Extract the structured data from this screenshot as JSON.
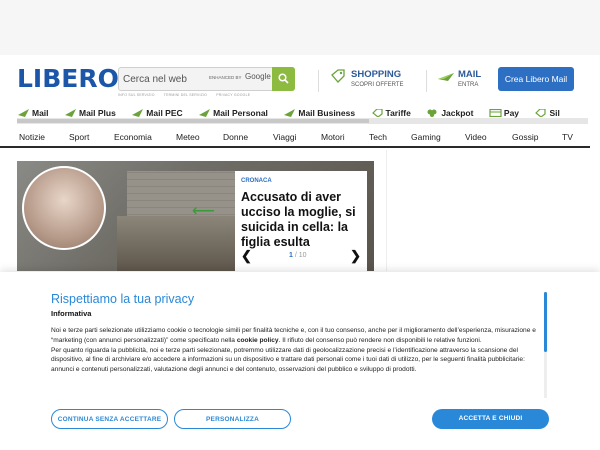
{
  "header": {
    "logo": "LIBERO",
    "search_placeholder": "Cerca nel web",
    "powered_by": "ENHANCED BY",
    "google": "Google",
    "sublinks": [
      "INFO SUL SERVIZIO",
      "TERMINI DEL SERVIZIO",
      "PRIVACY GOOGLE"
    ],
    "shopping_title": "SHOPPING",
    "shopping_sub": "SCOPRI OFFERTE",
    "mail_title": "MAIL",
    "mail_sub": "ENTRA",
    "crea_button": "Crea Libero Mail"
  },
  "services": [
    {
      "label": "Mail",
      "icon": "mail-icon"
    },
    {
      "label": "Mail Plus",
      "icon": "mail-icon"
    },
    {
      "label": "Mail PEC",
      "icon": "mail-icon"
    },
    {
      "label": "Mail Personal",
      "icon": "mail-icon"
    },
    {
      "label": "Mail Business",
      "icon": "mail-icon"
    },
    {
      "label": "Tariffe",
      "icon": "tag-icon"
    },
    {
      "label": "Jackpot",
      "icon": "clover-icon"
    },
    {
      "label": "Pay",
      "icon": "card-icon"
    },
    {
      "label": "Sil",
      "icon": "tag-icon"
    }
  ],
  "categories": [
    "Notizie",
    "Sport",
    "Economia",
    "Meteo",
    "Donne",
    "Viaggi",
    "Motori",
    "Tech",
    "Gaming",
    "Video",
    "Gossip",
    "TV"
  ],
  "hero": {
    "category": "CRONACA",
    "title": "Accusato di aver ucciso la moglie, si suicida in cella: la figlia esulta",
    "pager_current": "1",
    "pager_total": "/ 10"
  },
  "privacy": {
    "title": "Rispettiamo la tua privacy",
    "subtitle": "Informativa",
    "p1_a": "Noi e terze parti selezionate utilizziamo cookie o tecnologie simili per finalità tecniche e, con il tuo consenso, anche per il miglioramento dell’esperienza, misurazione e “marketing (con annunci personalizzati)” come specificato nella ",
    "p1_link": "cookie policy",
    "p1_b": ". Il rifiuto del consenso può rendere non disponibili le relative funzioni.",
    "p2": "Per quanto riguarda la pubblicità, noi e terze parti selezionate, potremmo utilizzare dati di geolocalizzazione precisi e l’identificazione attraverso la scansione del dispositivo, al fine di archiviare e/o accedere a informazioni su un dispositivo e trattare dati personali come i tuoi dati di utilizzo, per le seguenti finalità pubblicitarie: annunci e contenuti personalizzati, valutazione degli annunci e del contenuto, osservazioni del pubblico e sviluppo di prodotti.",
    "btn_reject": "CONTINUA SENZA ACCETTARE",
    "btn_customize": "PERSONALIZZA",
    "btn_accept": "ACCETTA E CHIUDI"
  },
  "colors": {
    "brand": "#1b56a8",
    "accent": "#2a88d8",
    "search_button": "#8cbb3f"
  }
}
